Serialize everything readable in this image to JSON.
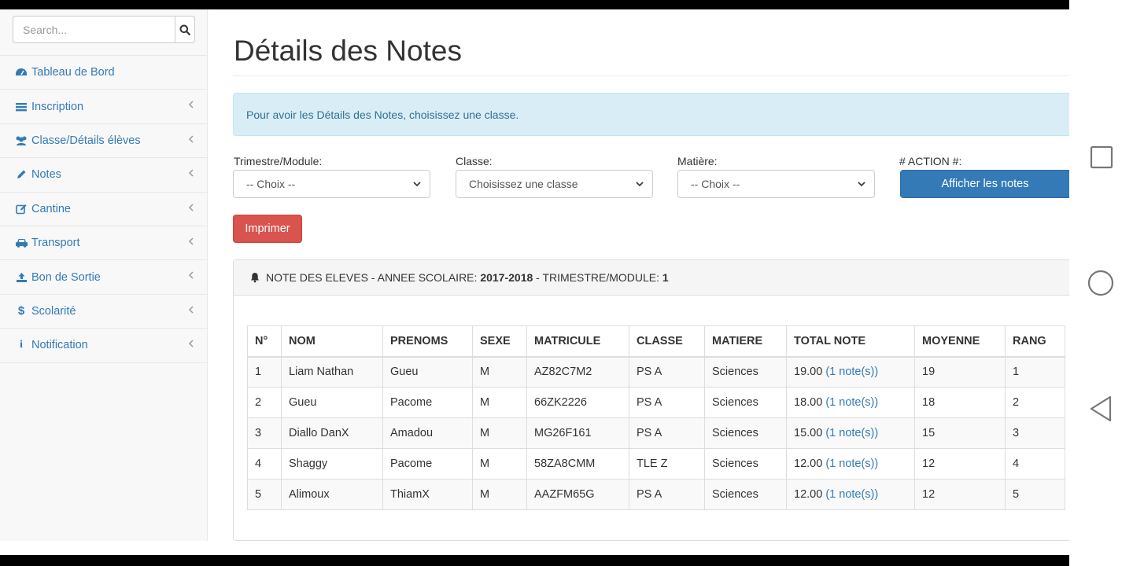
{
  "search": {
    "placeholder": "Search..."
  },
  "sidebar": {
    "items": [
      {
        "label": "Tableau de Bord",
        "icon": "dashboard-icon",
        "has_chevron": false
      },
      {
        "label": "Inscription",
        "icon": "list-icon",
        "has_chevron": true
      },
      {
        "label": "Classe/Détails élèves",
        "icon": "users-icon",
        "has_chevron": true
      },
      {
        "label": "Notes",
        "icon": "pencil-icon",
        "has_chevron": true
      },
      {
        "label": "Cantine",
        "icon": "edit-icon",
        "has_chevron": true
      },
      {
        "label": "Transport",
        "icon": "car-icon",
        "has_chevron": true
      },
      {
        "label": "Bon de Sortie",
        "icon": "upload-icon",
        "has_chevron": true
      },
      {
        "label": "Scolarité",
        "icon": "dollar-icon",
        "has_chevron": true
      },
      {
        "label": "Notification",
        "icon": "info-icon",
        "has_chevron": true
      }
    ]
  },
  "page": {
    "title": "Détails des Notes",
    "alert": "Pour avoir les Détails des Notes, choisissez une classe."
  },
  "filters": {
    "trimestre_label": "Trimestre/Module:",
    "trimestre_value": "-- Choix --",
    "classe_label": "Classe:",
    "classe_value": "Choisissez une classe",
    "matiere_label": "Matière:",
    "matiere_value": "-- Choix --",
    "action_label": "# ACTION #:",
    "show_button": "Afficher les notes"
  },
  "print_button": "Imprimer",
  "panel": {
    "heading_prefix": "NOTE DES ELEVES - ANNEE SCOLAIRE: ",
    "year": "2017-2018",
    "heading_mid": " - TRIMESTRE/MODULE: ",
    "module": "1"
  },
  "table": {
    "headers": [
      "N°",
      "NOM",
      "PRENOMS",
      "SEXE",
      "MATRICULE",
      "CLASSE",
      "MATIERE",
      "TOTAL NOTE",
      "MOYENNE",
      "RANG"
    ],
    "rows": [
      {
        "n": "1",
        "nom": "Liam Nathan",
        "prenoms": "Gueu",
        "sexe": "M",
        "matricule": "AZ82C7M2",
        "classe": "PS A",
        "matiere": "Sciences",
        "total": "19.00",
        "notes": "(1 note(s))",
        "moyenne": "19",
        "rang": "1"
      },
      {
        "n": "2",
        "nom": "Gueu",
        "prenoms": "Pacome",
        "sexe": "M",
        "matricule": "66ZK2226",
        "classe": "PS A",
        "matiere": "Sciences",
        "total": "18.00",
        "notes": "(1 note(s))",
        "moyenne": "18",
        "rang": "2"
      },
      {
        "n": "3",
        "nom": "Diallo DanX",
        "prenoms": "Amadou",
        "sexe": "M",
        "matricule": "MG26F161",
        "classe": "PS A",
        "matiere": "Sciences",
        "total": "15.00",
        "notes": "(1 note(s))",
        "moyenne": "15",
        "rang": "3"
      },
      {
        "n": "4",
        "nom": "Shaggy",
        "prenoms": "Pacome",
        "sexe": "M",
        "matricule": "58ZA8CMM",
        "classe": "TLE Z",
        "matiere": "Sciences",
        "total": "12.00",
        "notes": "(1 note(s))",
        "moyenne": "12",
        "rang": "4"
      },
      {
        "n": "5",
        "nom": "Alimoux",
        "prenoms": "ThiamX",
        "sexe": "M",
        "matricule": "AAZFM65G",
        "classe": "PS A",
        "matiere": "Sciences",
        "total": "12.00",
        "notes": "(1 note(s))",
        "moyenne": "12",
        "rang": "5"
      }
    ]
  },
  "colors": {
    "link": "#337ab7",
    "primary": "#337ab7",
    "danger": "#d9534f",
    "alert_bg": "#d9edf7"
  },
  "system_nav": [
    "recents-square-icon",
    "home-circle-icon",
    "back-triangle-icon"
  ]
}
